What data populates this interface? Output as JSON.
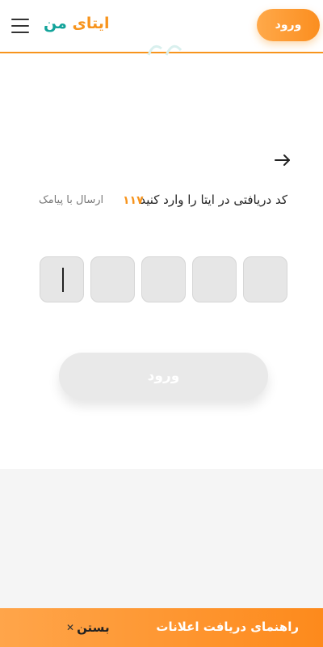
{
  "header": {
    "logo_part1": "ایتای",
    "logo_part2": "من",
    "login_button": "ورود",
    "accent_color": "#f7941d",
    "logo_secondary_color": "#12a39a",
    "menu_icon": "hamburger-menu-icon"
  },
  "verify": {
    "back_icon": "arrow-right-icon",
    "prompt": "کد دریافتی در ایتا را وارد کنید",
    "timer": "۱۱۷",
    "resend_sms": "ارسال با پیامک",
    "code_length": 5,
    "submit_label": "ورود"
  },
  "banner": {
    "title": "راهنمای دریافت اعلانات",
    "close_label": "بستن",
    "close_icon": "close-icon"
  }
}
